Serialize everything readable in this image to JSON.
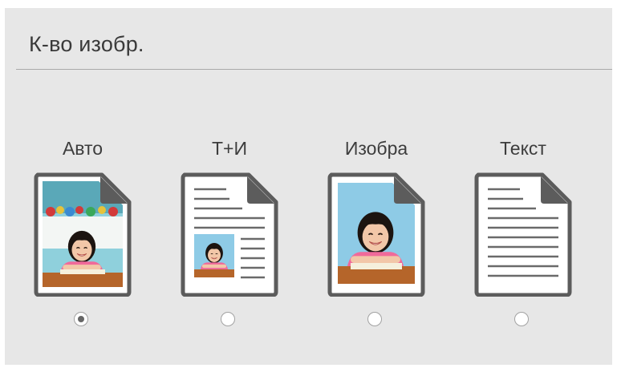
{
  "header": {
    "title": "К-во изобр."
  },
  "options": [
    {
      "id": "auto",
      "label": "Авто",
      "icon": "page-photo-full-icon",
      "selected": true
    },
    {
      "id": "text-image",
      "label": "Т+И",
      "icon": "page-text-and-photo-icon",
      "selected": false
    },
    {
      "id": "image",
      "label": "Изобра",
      "icon": "page-photo-icon",
      "selected": false
    },
    {
      "id": "text",
      "label": "Текст",
      "icon": "page-text-icon",
      "selected": false
    }
  ],
  "colors": {
    "panel_bg": "#e7e7e7",
    "doc_outline": "#5c5c5c",
    "text_lines": "#6a6a6a",
    "photo_sky": "#8ecbe6",
    "radio_selected_dot": "#666666"
  }
}
